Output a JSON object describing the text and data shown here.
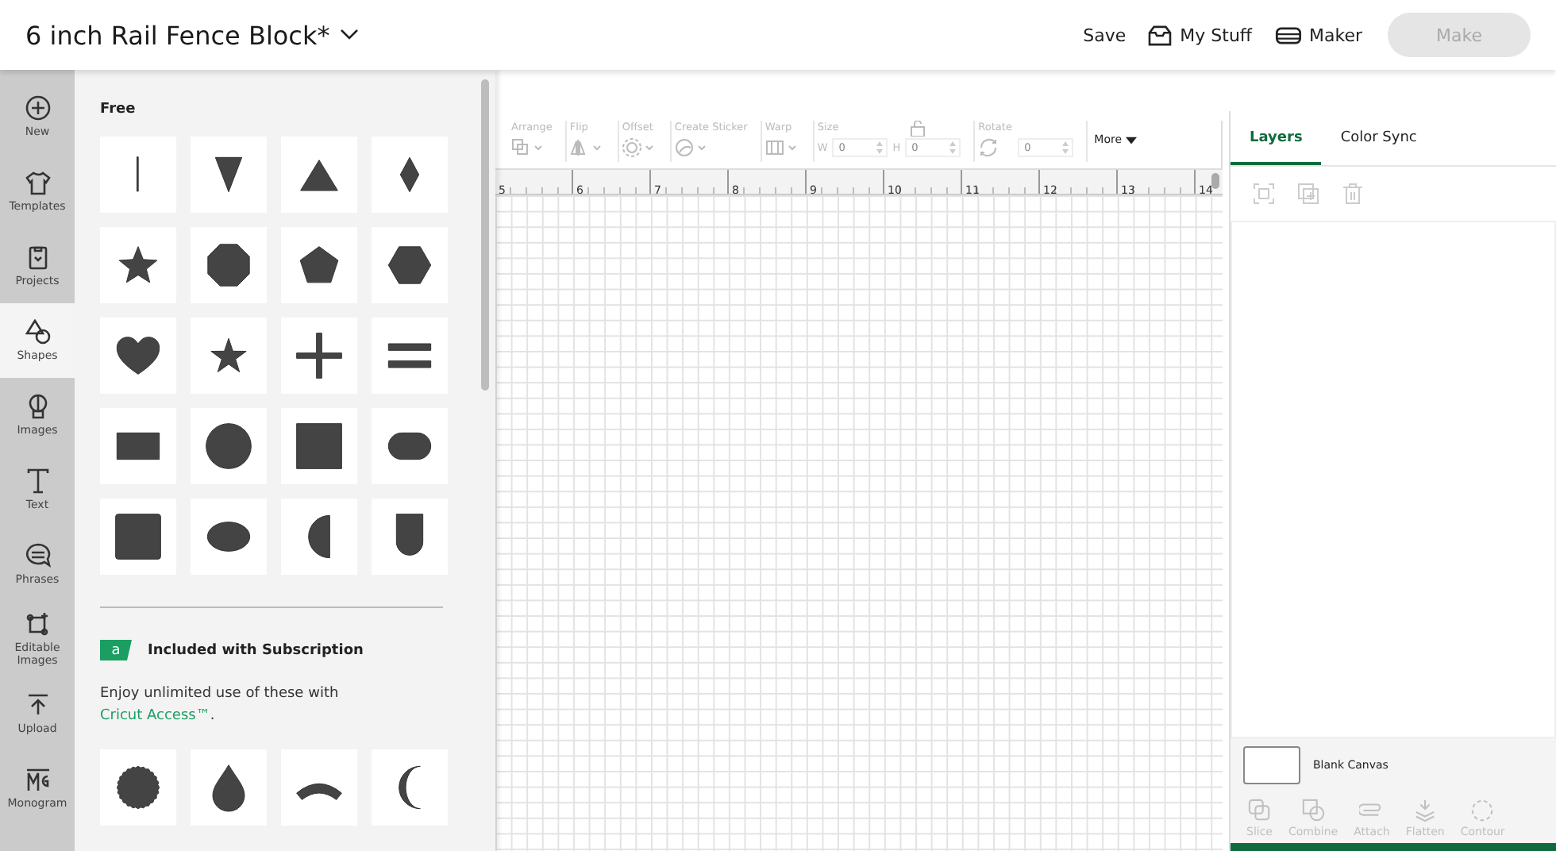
{
  "header": {
    "title": "6 inch Rail Fence Block*",
    "actions": [
      {
        "kind": "save",
        "label": "Save"
      },
      {
        "kind": "mystuff",
        "label": "My Stuff"
      },
      {
        "kind": "maker",
        "label": "Maker"
      }
    ],
    "make_button": {
      "label": "Make",
      "disabled": true
    }
  },
  "nav": [
    {
      "kind": "new",
      "label": "New",
      "selected": false
    },
    {
      "kind": "templates",
      "label": "Templates",
      "selected": false
    },
    {
      "kind": "projects",
      "label": "Projects",
      "selected": false
    },
    {
      "kind": "shapes",
      "label": "Shapes",
      "selected": true
    },
    {
      "kind": "images",
      "label": "Images",
      "selected": false
    },
    {
      "kind": "text",
      "label": "Text",
      "selected": false
    },
    {
      "kind": "phrases",
      "label": "Phrases",
      "selected": false
    },
    {
      "kind": "editable",
      "label": "Editable Images",
      "selected": false
    },
    {
      "kind": "upload",
      "label": "Upload",
      "selected": false
    },
    {
      "kind": "monogram",
      "label": "Monogram",
      "selected": false
    }
  ],
  "shapes_panel": {
    "free_heading": "Free",
    "free_shapes": [
      {
        "kind": "line"
      },
      {
        "kind": "triangle-down"
      },
      {
        "kind": "triangle"
      },
      {
        "kind": "diamond"
      },
      {
        "kind": "star"
      },
      {
        "kind": "octagon"
      },
      {
        "kind": "pentagon"
      },
      {
        "kind": "hexagon"
      },
      {
        "kind": "heart"
      },
      {
        "kind": "star-small"
      },
      {
        "kind": "cross"
      },
      {
        "kind": "equals"
      },
      {
        "kind": "rectangle"
      },
      {
        "kind": "circle"
      },
      {
        "kind": "square"
      },
      {
        "kind": "pill"
      },
      {
        "kind": "rounded-square"
      },
      {
        "kind": "oval"
      },
      {
        "kind": "half-circle"
      },
      {
        "kind": "arch"
      }
    ],
    "subscription_badge": "a",
    "subscription_heading": "Included with Subscription",
    "subscription_text": "Enjoy unlimited use of these with ",
    "subscription_link": "Cricut Access™",
    "subscription_end": ".",
    "subscription_shapes": [
      {
        "kind": "seal"
      },
      {
        "kind": "teardrop"
      },
      {
        "kind": "arc"
      },
      {
        "kind": "crescent"
      }
    ]
  },
  "toolbar": {
    "items": [
      {
        "kind": "arrange",
        "label": "Arrange"
      },
      {
        "kind": "flip",
        "label": "Flip"
      },
      {
        "kind": "offset",
        "label": "Offset"
      },
      {
        "kind": "sticker",
        "label": "Create Sticker"
      },
      {
        "kind": "warp",
        "label": "Warp"
      },
      {
        "kind": "size",
        "label": "Size",
        "fields": [
          {
            "label": "W",
            "value": "0"
          },
          {
            "label": "H",
            "value": "0"
          }
        ]
      },
      {
        "kind": "rotate",
        "label": "Rotate",
        "fields": [
          {
            "value": "0"
          }
        ]
      }
    ],
    "more": "More"
  },
  "ruler": [
    "5",
    "6",
    "7",
    "8",
    "9",
    "10",
    "11",
    "12",
    "13",
    "14"
  ],
  "layers_panel": {
    "tabs": [
      {
        "label": "Layers",
        "selected": true
      },
      {
        "label": "Color Sync",
        "selected": false
      }
    ],
    "layer": "Blank Canvas",
    "tools": [
      {
        "kind": "slice",
        "label": "Slice",
        "disabled": true
      },
      {
        "kind": "combine",
        "label": "Combine",
        "disabled": true
      },
      {
        "kind": "attach",
        "label": "Attach",
        "disabled": true
      },
      {
        "kind": "flatten",
        "label": "Flatten",
        "disabled": true
      },
      {
        "kind": "contour",
        "label": "Contour",
        "disabled": true
      }
    ]
  }
}
